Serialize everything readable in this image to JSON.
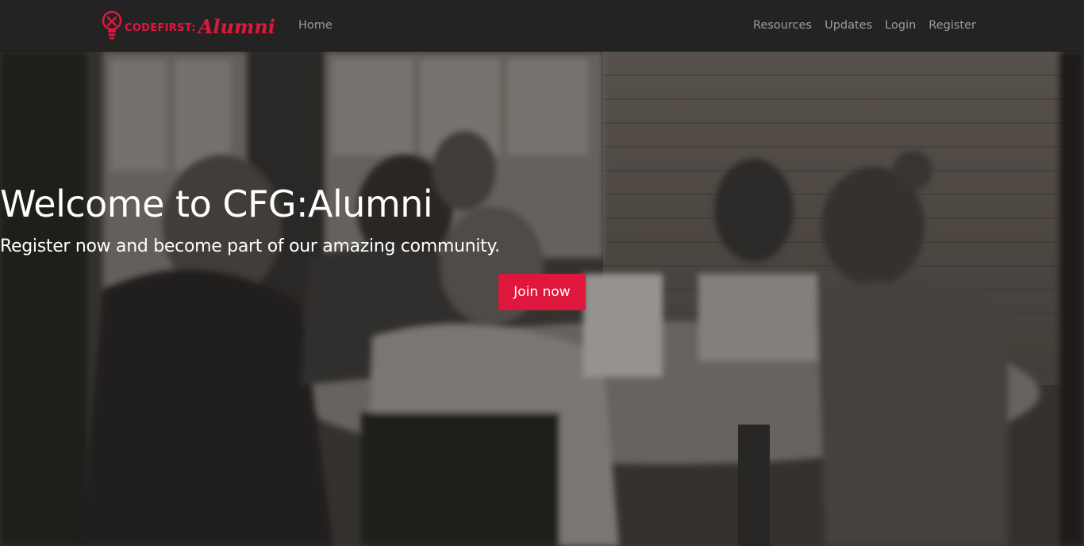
{
  "navbar": {
    "brand": {
      "code_text": "CODEFIRST:",
      "alumni_text": "Alumni",
      "brand_color": "#e0173c"
    },
    "home_label": "Home",
    "right_links": [
      {
        "label": "Resources"
      },
      {
        "label": "Updates"
      },
      {
        "label": "Login"
      },
      {
        "label": "Register"
      }
    ],
    "background_color": "#232323",
    "link_color": "#9d9d9d"
  },
  "hero": {
    "title": "Welcome to CFG:Alumni",
    "subtitle": "Register now and become part of our amazing community.",
    "cta_label": "Join now",
    "cta_color": "#e0173c",
    "background_description_icon": "photo-background"
  }
}
